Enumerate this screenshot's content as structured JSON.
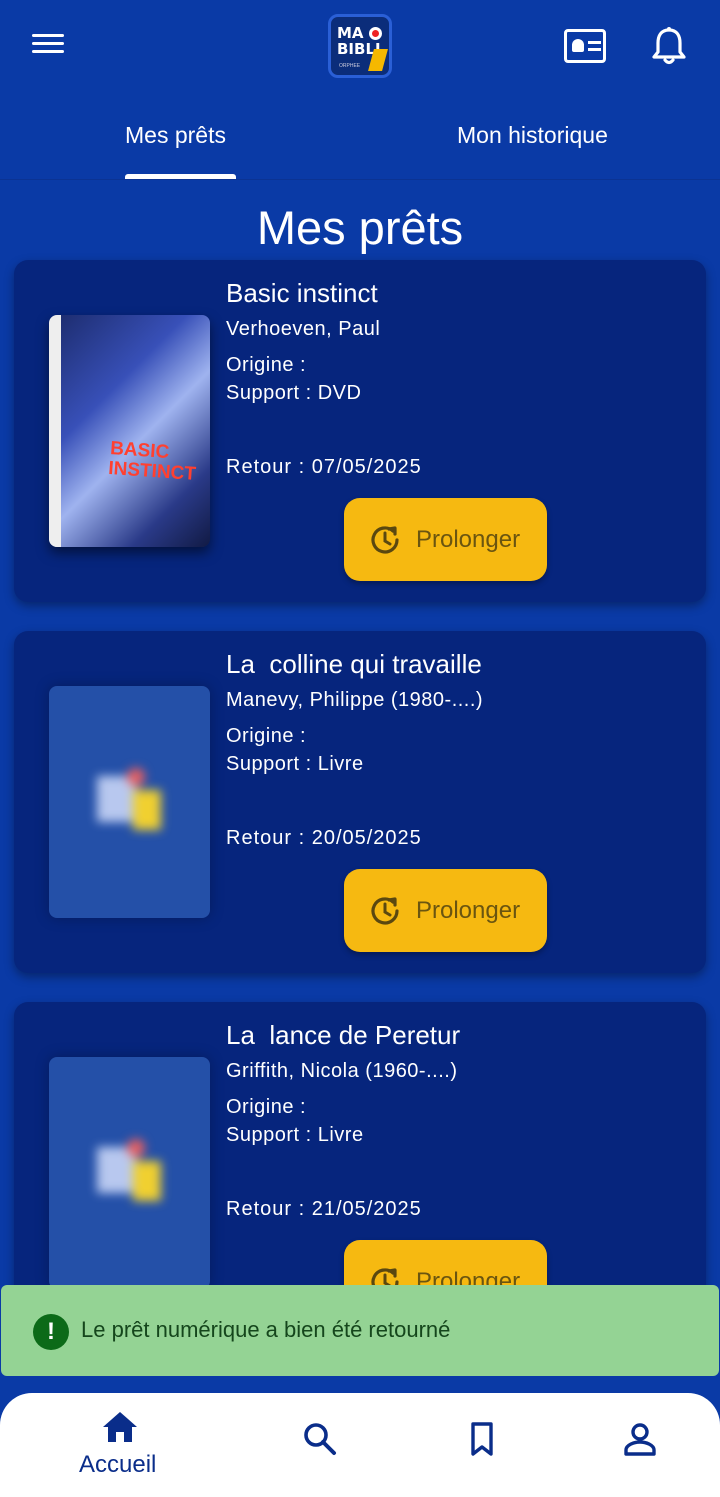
{
  "header": {
    "logo_text": "MA BIBLI",
    "logo_subtext": "ORPHEE",
    "icons": [
      "menu-icon",
      "id-card-icon",
      "bell-icon"
    ]
  },
  "tabs": [
    {
      "label": "Mes prêts",
      "active": true
    },
    {
      "label": "Mon historique",
      "active": false
    }
  ],
  "page_title": "Mes prêts",
  "loans": [
    {
      "title": "Basic instinct",
      "author": "Verhoeven, Paul",
      "origin": "Origine :",
      "support": "Support : DVD",
      "return": "Retour : 07/05/2025",
      "button": "Prolonger",
      "cover_text": "BASIC INSTINCT"
    },
    {
      "title": "La  colline qui travaille",
      "author": "Manevy, Philippe (1980-....)",
      "origin": "Origine :",
      "support": "Support : Livre",
      "return": "Retour : 20/05/2025",
      "button": "Prolonger"
    },
    {
      "title": "La  lance de Peretur",
      "author": "Griffith, Nicola (1960-....)",
      "origin": "Origine :",
      "support": "Support : Livre",
      "return": "Retour : 21/05/2025",
      "button": "Prolonger"
    }
  ],
  "snackbar": {
    "message": "Le prêt numérique a bien été retourné",
    "icon": "alert-circle-icon",
    "color": "#94d394"
  },
  "bottom_nav": {
    "home_label": "Accueil",
    "items": [
      "home-icon",
      "search-icon",
      "bookmark-icon",
      "account-icon"
    ]
  },
  "colors": {
    "background": "#0a3aa6",
    "card": "#06257d",
    "button": "#f6b911",
    "nav_active": "#0a2d8a"
  }
}
